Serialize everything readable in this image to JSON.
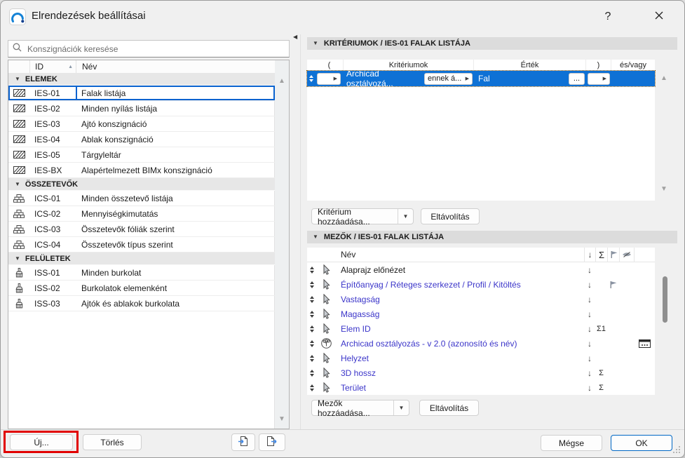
{
  "window": {
    "title": "Elrendezések beállításai",
    "help": "?"
  },
  "glyphs": {
    "down": "▼",
    "up": "▲",
    "right": "▶",
    "left": "◀",
    "sort_asc": "▲",
    "col_sort": "↓",
    "sum_header": "Σ"
  },
  "left": {
    "search_placeholder": "Konszignációk keresése",
    "header": {
      "id": "ID",
      "name": "Név"
    },
    "sections": [
      {
        "label": "ELEMEK",
        "items": [
          {
            "id": "IES-01",
            "name": "Falak listája"
          },
          {
            "id": "IES-02",
            "name": "Minden nyílás listája"
          },
          {
            "id": "IES-03",
            "name": "Ajtó konszignáció"
          },
          {
            "id": "IES-04",
            "name": "Ablak konszignáció"
          },
          {
            "id": "IES-05",
            "name": "Tárgyleltár"
          },
          {
            "id": "IES-BX",
            "name": "Alapértelmezett BIMx konszignáció"
          }
        ]
      },
      {
        "label": "ÖSSZETEVŐK",
        "items": [
          {
            "id": "ICS-01",
            "name": "Minden összetevő listája"
          },
          {
            "id": "ICS-02",
            "name": "Mennyiségkimutatás"
          },
          {
            "id": "ICS-03",
            "name": "Összetevők fóliák szerint"
          },
          {
            "id": "ICS-04",
            "name": "Összetevők típus szerint"
          }
        ]
      },
      {
        "label": "FELÜLETEK",
        "items": [
          {
            "id": "ISS-01",
            "name": "Minden burkolat"
          },
          {
            "id": "ISS-02",
            "name": "Burkolatok elemenként"
          },
          {
            "id": "ISS-03",
            "name": "Ajtók és ablakok burkolata"
          }
        ]
      }
    ],
    "new_button": "Új...",
    "delete_button": "Törlés"
  },
  "criteria": {
    "title": "KRITÉRIUMOK / IES-01 FALAK LISTÁJA",
    "columns": {
      "open": "(",
      "criterion": "Kritériumok",
      "value": "Érték",
      "close": ")",
      "andor": "és/vagy"
    },
    "row": {
      "criterion": "Archicad osztályozá...",
      "condition": "ennek á...",
      "value": "Fal",
      "more": "..."
    },
    "add_button": "Kritérium hozzáadása...",
    "remove_button": "Eltávolítás"
  },
  "fields": {
    "title": "MEZŐK / IES-01 FALAK LISTÁJA",
    "name_header": "Név",
    "rows": [
      {
        "name": "Alaprajz előnézet",
        "sum": ""
      },
      {
        "name": "Építőanyag / Réteges szerkezet / Profil / Kitöltés",
        "sum": ""
      },
      {
        "name": "Vastagság",
        "sum": ""
      },
      {
        "name": "Magasság",
        "sum": ""
      },
      {
        "name": "Elem ID",
        "sum": "Σ1"
      },
      {
        "name": "Archicad osztályozás - v 2.0 (azonosító és név)",
        "sum": ""
      },
      {
        "name": "Helyzet",
        "sum": ""
      },
      {
        "name": "3D hossz",
        "sum": "Σ"
      },
      {
        "name": "Terület",
        "sum": "Σ"
      }
    ],
    "add_button": "Mezők hozzáadása...",
    "remove_button": "Eltávolítás"
  },
  "footer": {
    "cancel": "Mégse",
    "ok": "OK"
  },
  "colors": {
    "selection_blue": "#0e71d5",
    "field_link_blue": "#3b35c9",
    "annotation_red": "#e10000",
    "arrow_blue": "#3f87e5"
  }
}
